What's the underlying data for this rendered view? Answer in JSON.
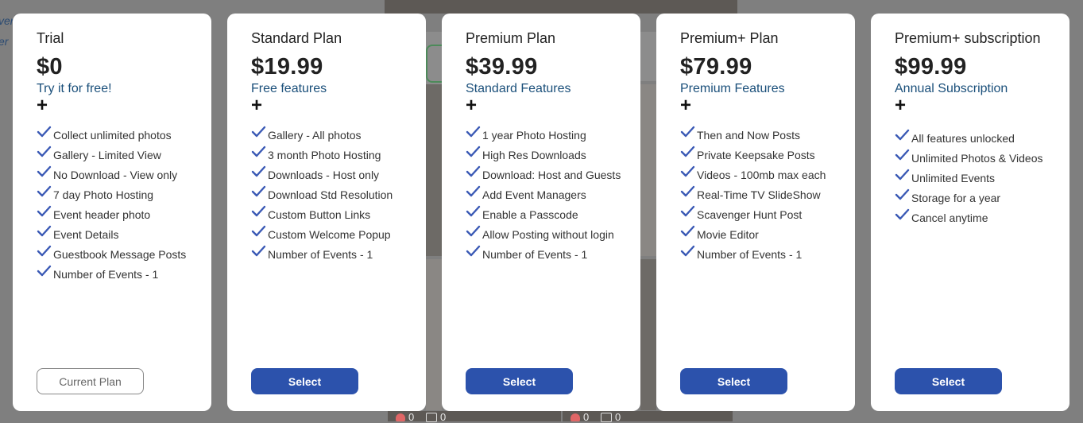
{
  "background": {
    "left_text": [
      "ver",
      "er"
    ],
    "stats": [
      {
        "count": "0"
      },
      {
        "count": "0"
      },
      {
        "count": "0"
      },
      {
        "count": "0"
      }
    ]
  },
  "colors": {
    "accent": "#2c52ac",
    "subtitle": "#1a4f7a",
    "check": "#3a59b5"
  },
  "plans": [
    {
      "name": "Trial",
      "price": "$0",
      "subtitle": "Try it for free!",
      "plus": "+",
      "features": [
        "Collect unlimited photos",
        "Gallery - Limited View",
        "No Download - View only",
        "7 day Photo Hosting",
        "Event header photo",
        "Event Details",
        "Guestbook Message Posts",
        "Number of Events - 1"
      ],
      "button": "Current Plan"
    },
    {
      "name": "Standard Plan",
      "price": "$19.99",
      "subtitle": "Free features",
      "plus": "+",
      "features": [
        "Gallery - All photos",
        "3 month Photo Hosting",
        "Downloads - Host only",
        "Download Std Resolution",
        "Custom Button Links",
        "Custom Welcome Popup",
        "Number of Events - 1"
      ],
      "button": "Select"
    },
    {
      "name": "Premium Plan",
      "price": "$39.99",
      "subtitle": "Standard Features",
      "plus": "+",
      "features": [
        "1 year Photo Hosting",
        "High Res Downloads",
        "Download: Host and Guests",
        "Add Event Managers",
        "Enable a Passcode",
        "Allow Posting without login",
        "Number of Events - 1"
      ],
      "button": "Select"
    },
    {
      "name": "Premium+ Plan",
      "price": "$79.99",
      "subtitle": "Premium Features",
      "plus": "+",
      "features": [
        "Then and Now Posts",
        "Private Keepsake Posts",
        "Videos - 100mb max each",
        "Real-Time TV SlideShow",
        "Scavenger Hunt Post",
        "Movie Editor",
        "Number of Events - 1"
      ],
      "button": "Select"
    },
    {
      "name": "Premium+ subscription",
      "price": "$99.99",
      "subtitle": "Annual Subscription",
      "plus": "+",
      "features": [
        "All features unlocked",
        "Unlimited Photos & Videos",
        "Unlimited Events",
        "Storage for a year",
        "Cancel anytime"
      ],
      "button": "Select"
    }
  ]
}
